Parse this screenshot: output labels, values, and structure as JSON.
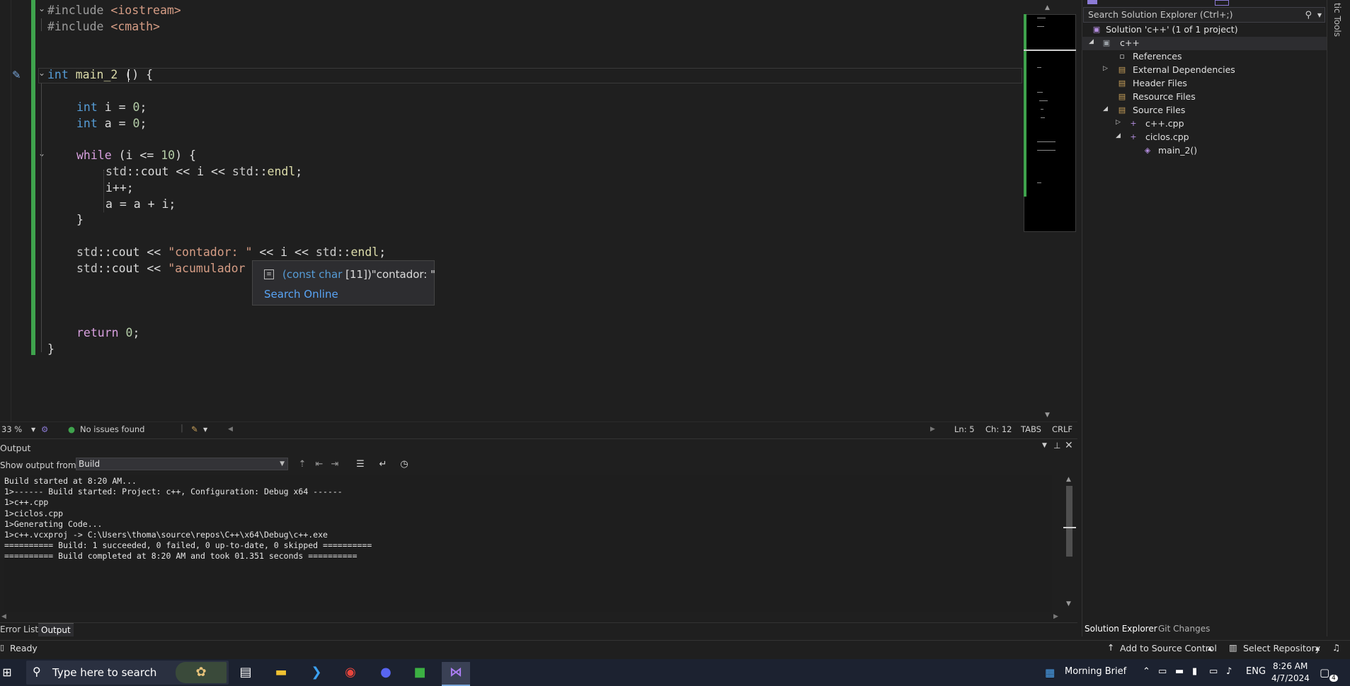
{
  "editor": {
    "lines": [
      {
        "row": 0,
        "tokens": [
          {
            "t": "#include ",
            "c": "pp"
          },
          {
            "t": "<iostream>",
            "c": "inc"
          }
        ]
      },
      {
        "row": 1,
        "tokens": [
          {
            "t": "#include ",
            "c": "pp"
          },
          {
            "t": "<cmath>",
            "c": "inc"
          }
        ]
      },
      {
        "row": 4,
        "tokens": [
          {
            "t": "int ",
            "c": "kw"
          },
          {
            "t": "main_2 ",
            "c": "fn"
          },
          {
            "t": "() {",
            "c": "txt"
          }
        ]
      },
      {
        "row": 6,
        "indent": 1,
        "tokens": [
          {
            "t": "int ",
            "c": "kw"
          },
          {
            "t": "i = ",
            "c": "txt"
          },
          {
            "t": "0",
            "c": "num"
          },
          {
            "t": ";",
            "c": "txt"
          }
        ]
      },
      {
        "row": 7,
        "indent": 1,
        "tokens": [
          {
            "t": "int ",
            "c": "kw"
          },
          {
            "t": "a = ",
            "c": "txt"
          },
          {
            "t": "0",
            "c": "num"
          },
          {
            "t": ";",
            "c": "txt"
          }
        ]
      },
      {
        "row": 9,
        "indent": 1,
        "tokens": [
          {
            "t": "while ",
            "c": "kw2"
          },
          {
            "t": "(i <= ",
            "c": "txt"
          },
          {
            "t": "10",
            "c": "num"
          },
          {
            "t": ") {",
            "c": "txt"
          }
        ]
      },
      {
        "row": 10,
        "indent": 2,
        "tokens": [
          {
            "t": "std",
            "c": "ns"
          },
          {
            "t": "::",
            "c": "txt"
          },
          {
            "t": "cout",
            "c": "txt"
          },
          {
            "t": " << i << ",
            "c": "txt"
          },
          {
            "t": "std",
            "c": "ns"
          },
          {
            "t": "::",
            "c": "txt"
          },
          {
            "t": "endl",
            "c": "fn"
          },
          {
            "t": ";",
            "c": "txt"
          }
        ]
      },
      {
        "row": 11,
        "indent": 2,
        "tokens": [
          {
            "t": "i++;",
            "c": "txt"
          }
        ]
      },
      {
        "row": 12,
        "indent": 2,
        "tokens": [
          {
            "t": "a = a + i;",
            "c": "txt"
          }
        ]
      },
      {
        "row": 13,
        "indent": 1,
        "tokens": [
          {
            "t": "}",
            "c": "txt"
          }
        ]
      },
      {
        "row": 15,
        "indent": 1,
        "tokens": [
          {
            "t": "std",
            "c": "ns"
          },
          {
            "t": "::",
            "c": "txt"
          },
          {
            "t": "cout",
            "c": "txt"
          },
          {
            "t": " << ",
            "c": "txt"
          },
          {
            "t": "\"contador: \"",
            "c": "str"
          },
          {
            "t": " << i << ",
            "c": "txt"
          },
          {
            "t": "std",
            "c": "ns"
          },
          {
            "t": "::",
            "c": "txt"
          },
          {
            "t": "endl",
            "c": "fn"
          },
          {
            "t": ";",
            "c": "txt"
          }
        ]
      },
      {
        "row": 16,
        "indent": 1,
        "tokens": [
          {
            "t": "std",
            "c": "ns"
          },
          {
            "t": "::",
            "c": "txt"
          },
          {
            "t": "cout",
            "c": "txt"
          },
          {
            "t": " << ",
            "c": "txt"
          },
          {
            "t": "\"acumulador",
            "c": "str"
          }
        ]
      },
      {
        "row": 20,
        "indent": 1,
        "tokens": [
          {
            "t": "return ",
            "c": "kw2"
          },
          {
            "t": "0",
            "c": "num"
          },
          {
            "t": ";",
            "c": "txt"
          }
        ]
      },
      {
        "row": 21,
        "tokens": [
          {
            "t": "}",
            "c": "txt"
          }
        ]
      }
    ]
  },
  "tooltip": {
    "type_prefix": "(const char ",
    "type_size": "[11]",
    "type_close": ")",
    "value": "\"contador: \"",
    "search_link": "Search Online"
  },
  "editor_status": {
    "zoom": "33 %",
    "issues": "No issues found",
    "line": "Ln: 5",
    "char": "Ch: 12",
    "indent": "TABS",
    "eol": "CRLF"
  },
  "output": {
    "title": "Output",
    "source_label": "Show output from:",
    "source_value": "Build",
    "lines": [
      "Build started at 8:20 AM...",
      "1>------ Build started: Project: c++, Configuration: Debug x64 ------",
      "1>c++.cpp",
      "1>ciclos.cpp",
      "1>Generating Code...",
      "1>c++.vcxproj -> C:\\Users\\thoma\\source\\repos\\C++\\x64\\Debug\\c++.exe",
      "========== Build: 1 succeeded, 0 failed, 0 up-to-date, 0 skipped ==========",
      "========== Build completed at 8:20 AM and took 01.351 seconds =========="
    ]
  },
  "bottom_tabs": [
    "Error List",
    "Output"
  ],
  "solution_explorer": {
    "search_placeholder": "Search Solution Explorer (Ctrl+;)",
    "tree": [
      {
        "label": "Solution 'c++' (1 of 1 project)"
      },
      {
        "label": "c++"
      },
      {
        "label": "References"
      },
      {
        "label": "External Dependencies"
      },
      {
        "label": "Header Files"
      },
      {
        "label": "Resource Files"
      },
      {
        "label": "Source Files"
      },
      {
        "label": "c++.cpp"
      },
      {
        "label": "ciclos.cpp"
      },
      {
        "label": "main_2()"
      }
    ],
    "tabs": [
      "Solution Explorer",
      "Git Changes"
    ]
  },
  "side_panel_label": "tic Tools",
  "status_bar": {
    "ready": "Ready",
    "add_source": "Add to Source Control",
    "select_repo": "Select Repository"
  },
  "taskbar": {
    "search_placeholder": "Type here to search",
    "weather": "Morning Brief",
    "lang": "ENG",
    "time": "8:26 AM",
    "date": "4/7/2024",
    "notif_count": "4"
  },
  "colors": {
    "accent_green": "#3fa34d",
    "link_blue": "#59a4f5",
    "keyword_blue": "#569cd6",
    "keyword_purple": "#d8a0df"
  }
}
